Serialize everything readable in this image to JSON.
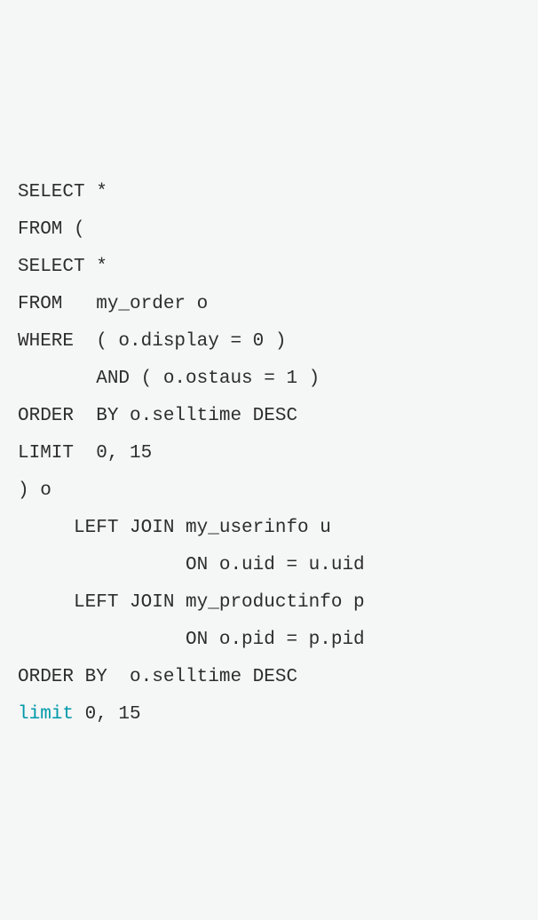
{
  "code": {
    "line1": "SELECT *",
    "line2": "FROM (",
    "line3": "SELECT *",
    "line4": "FROM   my_order o",
    "line5": "WHERE  ( o.display = 0 )",
    "line6": "       AND ( o.ostaus = 1 )",
    "line7": "ORDER  BY o.selltime DESC",
    "line8": "LIMIT  0, 15",
    "line9": ") o",
    "line10": "     LEFT JOIN my_userinfo u",
    "line11": "               ON o.uid = u.uid",
    "line12": "     LEFT JOIN my_productinfo p",
    "line13": "               ON o.pid = p.pid",
    "line14": "ORDER BY  o.selltime DESC",
    "line15_highlight": "limit",
    "line15_rest": " 0, 15"
  }
}
